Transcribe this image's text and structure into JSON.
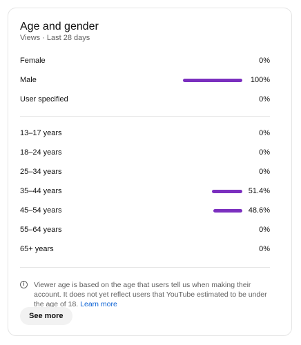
{
  "card": {
    "title": "Age and gender",
    "subtitle": "Views · Last 28 days"
  },
  "colors": {
    "bar": "#7b2fbf",
    "link": "#065fd4"
  },
  "gender": [
    {
      "label": "Female",
      "value": "0%",
      "fraction": 0
    },
    {
      "label": "Male",
      "value": "100%",
      "fraction": 1.0
    },
    {
      "label": "User specified",
      "value": "0%",
      "fraction": 0
    }
  ],
  "age": [
    {
      "label": "13–17 years",
      "value": "0%",
      "fraction": 0
    },
    {
      "label": "18–24 years",
      "value": "0%",
      "fraction": 0
    },
    {
      "label": "25–34 years",
      "value": "0%",
      "fraction": 0
    },
    {
      "label": "35–44 years",
      "value": "51.4%",
      "fraction": 0.514
    },
    {
      "label": "45–54 years",
      "value": "48.6%",
      "fraction": 0.486
    },
    {
      "label": "55–64 years",
      "value": "0%",
      "fraction": 0
    },
    {
      "label": "65+ years",
      "value": "0%",
      "fraction": 0
    }
  ],
  "note": {
    "icon": "info-icon",
    "text": "Viewer age is based on the age that users tell us when making their account. It does not yet reflect users that YouTube estimated to be under the age of 18. ",
    "link": "Learn more"
  },
  "see_more_label": "See more"
}
